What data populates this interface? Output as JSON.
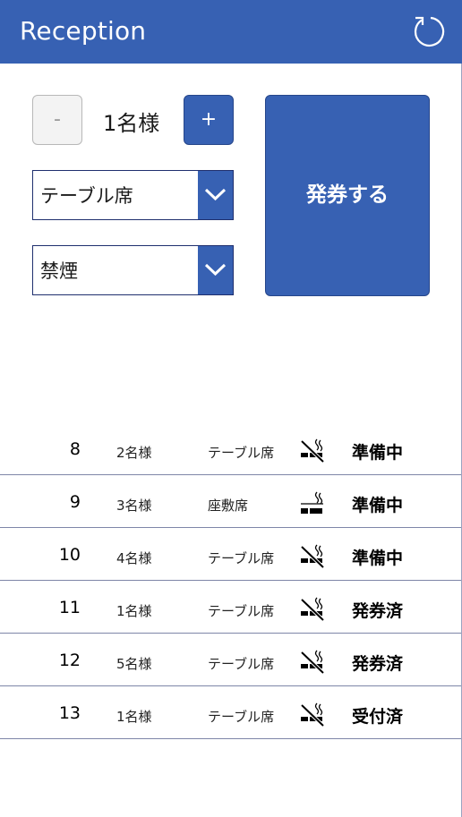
{
  "header": {
    "title": "Reception",
    "refresh_icon": "refresh-icon",
    "background": "#3761b3"
  },
  "form": {
    "minus_label": "-",
    "plus_label": "+",
    "party_count": "1名様",
    "seat_type": "テーブル席",
    "smoking": "禁煙",
    "issue_label": "発券する"
  },
  "tickets": [
    {
      "number": "8",
      "people": "2名様",
      "seat": "テーブル席",
      "smoking_icon": "no-smoking-icon",
      "status": "準備中"
    },
    {
      "number": "9",
      "people": "3名様",
      "seat": "座敷席",
      "smoking_icon": "smoking-icon",
      "status": "準備中"
    },
    {
      "number": "10",
      "people": "4名様",
      "seat": "テーブル席",
      "smoking_icon": "no-smoking-icon",
      "status": "準備中"
    },
    {
      "number": "11",
      "people": "1名様",
      "seat": "テーブル席",
      "smoking_icon": "no-smoking-icon",
      "status": "発券済"
    },
    {
      "number": "12",
      "people": "5名様",
      "seat": "テーブル席",
      "smoking_icon": "no-smoking-icon",
      "status": "発券済"
    },
    {
      "number": "13",
      "people": "1名様",
      "seat": "テーブル席",
      "smoking_icon": "no-smoking-icon",
      "status": "受付済"
    }
  ]
}
